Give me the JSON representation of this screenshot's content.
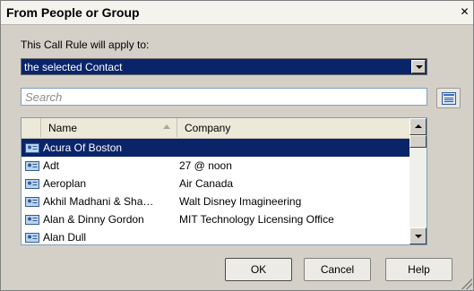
{
  "dialog": {
    "title": "From People or Group",
    "close_glyph": "✕"
  },
  "rule": {
    "label": "This Call Rule will apply to:",
    "selected": "the selected Contact"
  },
  "search": {
    "placeholder": "Search"
  },
  "list": {
    "columns": [
      "Name",
      "Company"
    ],
    "sort_indicator": "ascending",
    "rows": [
      {
        "name": "Acura Of Boston",
        "company": "",
        "selected": true
      },
      {
        "name": "Adt",
        "company": "27 @ noon",
        "selected": false
      },
      {
        "name": "Aeroplan",
        "company": "Air Canada",
        "selected": false
      },
      {
        "name": "Akhil Madhani & Sha…",
        "company": "Walt Disney Imagineering",
        "selected": false
      },
      {
        "name": "Alan & Dinny Gordon",
        "company": "MIT Technology Licensing Office",
        "selected": false
      },
      {
        "name": "Alan Dull",
        "company": "",
        "selected": false
      }
    ]
  },
  "buttons": {
    "ok": "OK",
    "cancel": "Cancel",
    "help": "Help"
  },
  "icons": {
    "contact": "contact-card-icon",
    "address_book": "address-book-icon",
    "close": "close-icon"
  },
  "colors": {
    "selection": "#0a246a",
    "dialog_bg": "#d4d0c8"
  }
}
